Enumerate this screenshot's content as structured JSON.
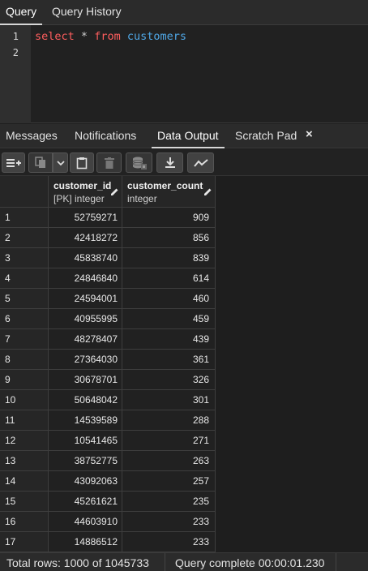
{
  "query_tabs": [
    "Query",
    "Query History"
  ],
  "editor": {
    "line_numbers": [
      "1",
      "2"
    ],
    "code": {
      "kw1": "select",
      "star": "*",
      "kw2": "from",
      "table": "customers"
    }
  },
  "panel_tabs": [
    "Messages",
    "Notifications",
    "Data Output",
    "Scratch Pad"
  ],
  "panel_close": "×",
  "toolbar": {
    "icons": [
      "add-row-icon",
      "copy-icon",
      "dropdown-icon",
      "paste-icon",
      "delete-icon",
      "save-data-icon",
      "download-icon",
      "graph-icon"
    ]
  },
  "grid": {
    "columns": [
      {
        "name": "customer_id",
        "type": "[PK] integer"
      },
      {
        "name": "customer_count",
        "type": "integer"
      }
    ],
    "rows": [
      [
        "1",
        "52759271",
        "909"
      ],
      [
        "2",
        "42418272",
        "856"
      ],
      [
        "3",
        "45838740",
        "839"
      ],
      [
        "4",
        "24846840",
        "614"
      ],
      [
        "5",
        "24594001",
        "460"
      ],
      [
        "6",
        "40955995",
        "459"
      ],
      [
        "7",
        "48278407",
        "439"
      ],
      [
        "8",
        "27364030",
        "361"
      ],
      [
        "9",
        "30678701",
        "326"
      ],
      [
        "10",
        "50648042",
        "301"
      ],
      [
        "11",
        "14539589",
        "288"
      ],
      [
        "12",
        "10541465",
        "271"
      ],
      [
        "13",
        "38752775",
        "263"
      ],
      [
        "14",
        "43092063",
        "257"
      ],
      [
        "15",
        "45261621",
        "235"
      ],
      [
        "16",
        "44603910",
        "233"
      ],
      [
        "17",
        "14886512",
        "233"
      ]
    ]
  },
  "status": {
    "total_rows": "Total rows: 1000 of 1045733",
    "query_complete": "Query complete 00:00:01.230"
  }
}
